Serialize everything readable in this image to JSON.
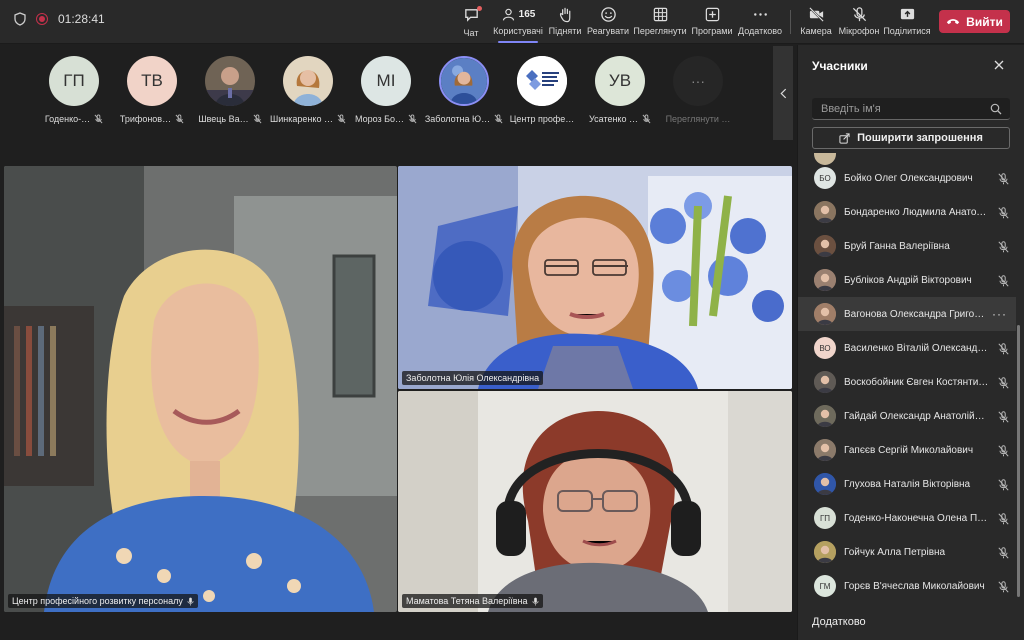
{
  "header": {
    "timer": "01:28:41",
    "participants_count": "165",
    "buttons": {
      "chat": "Чат",
      "people": "Користувачі",
      "raise": "Підняти",
      "react": "Реагувати",
      "view": "Переглянути",
      "apps": "Програми",
      "more": "Додатково",
      "camera": "Камера",
      "mic": "Мікрофон",
      "share": "Поділитися"
    },
    "leave": "Вийти"
  },
  "strip": {
    "people": [
      {
        "initials": "ГП",
        "name": "Годенко-…",
        "bg": "#d7e0d5"
      },
      {
        "initials": "ТВ",
        "name": "Трифонов…",
        "bg": "#f1d3c8"
      },
      {
        "initials": "",
        "name": "Швець Ва…",
        "bg": "#7a6a5a"
      },
      {
        "initials": "",
        "name": "Шинкаренко …",
        "bg": "#d9c7a6"
      },
      {
        "initials": "МІ",
        "name": "Мороз Бо…",
        "bg": "#dde6e4"
      },
      {
        "initials": "",
        "name": "Заболотна Ю…",
        "bg": "#4d6fb5"
      },
      {
        "initials": "",
        "name": "Центр профе…",
        "bg": "#ffffff"
      },
      {
        "initials": "УВ",
        "name": "Усатенко …",
        "bg": "#dde6d8"
      },
      {
        "initials": "···",
        "name": "Переглянути …",
        "bg": "#262626"
      }
    ]
  },
  "videos": {
    "main_label": "Центр професійного розвитку персоналу",
    "top_right_label": "Заболотна Юлія Олександрівна",
    "bottom_right_label": "Маматова Тетяна Валеріївна"
  },
  "panel": {
    "title": "Учасники",
    "search_placeholder": "Введіть ім'я",
    "invite": "Поширити запрошення",
    "participants": [
      {
        "initials": "БО",
        "name": "Бойко Олег Олександрович",
        "photo": false,
        "color": "#dfe5e3"
      },
      {
        "initials": "",
        "name": "Бондаренко Людмила Анатол…",
        "photo": true,
        "color": "#8a7560"
      },
      {
        "initials": "",
        "name": "Бруй Ганна Валеріївна",
        "photo": true,
        "color": "#6b5040"
      },
      {
        "initials": "",
        "name": "Бубліков Андрій Вікторович",
        "photo": true,
        "color": "#9a8070"
      },
      {
        "initials": "",
        "name": "Вагонова Олександра Григо…",
        "photo": true,
        "color": "#a07e68"
      },
      {
        "initials": "ВО",
        "name": "Василенко Віталій Олександр…",
        "photo": false,
        "color": "#f0d5cb"
      },
      {
        "initials": "",
        "name": "Воскобойник Євген Костянти…",
        "photo": true,
        "color": "#5f5a55"
      },
      {
        "initials": "",
        "name": "Гайдай Олександр Анатолійо…",
        "photo": true,
        "color": "#6e6a5c"
      },
      {
        "initials": "",
        "name": "Гапєєв Сергій Миколайович",
        "photo": true,
        "color": "#8b7a6a"
      },
      {
        "initials": "",
        "name": "Глухова Наталія Вікторівна",
        "photo": true,
        "color": "#3056a8"
      },
      {
        "initials": "ГП",
        "name": "Годенко-Наконечна Олена П…",
        "photo": false,
        "color": "#d8e0d6"
      },
      {
        "initials": "",
        "name": "Гойчук Алла Петрівна",
        "photo": true,
        "color": "#b5a060"
      },
      {
        "initials": "ГМ",
        "name": "Горєв В'ячеслав Миколайович",
        "photo": false,
        "color": "#dce6dd"
      }
    ],
    "more": "Додатково"
  }
}
